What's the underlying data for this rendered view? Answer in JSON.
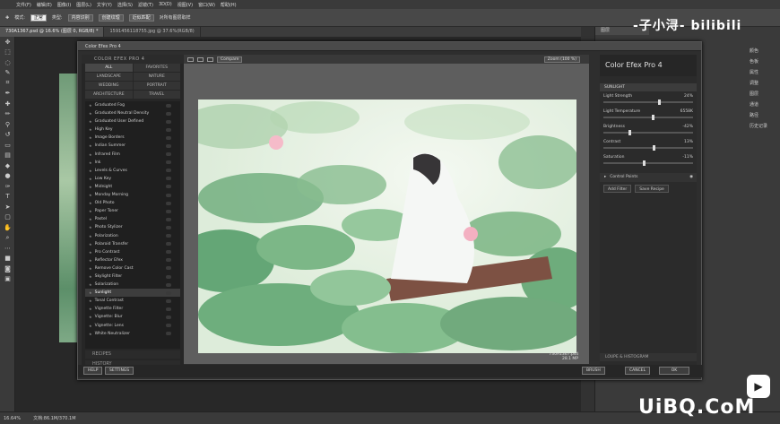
{
  "menu": [
    "文件(F)",
    "编辑(E)",
    "图像(I)",
    "图层(L)",
    "文字(Y)",
    "选择(S)",
    "滤镜(T)",
    "3D(D)",
    "视图(V)",
    "窗口(W)",
    "帮助(H)"
  ],
  "options": {
    "mode_label": "模式:",
    "mode_value": "正常",
    "type_label": "类型:",
    "btn1": "内容识别",
    "btn2": "创建纹理",
    "btn3": "近似匹配",
    "sample_all": "对所有图层取样"
  },
  "doc_tabs": [
    "730A1367.psd @ 16.6% (图层 0, RGB/8) *",
    "1591456118755.jpg @ 37.6%(RGB/8)"
  ],
  "right_panel": {
    "tab": "图层",
    "items": [
      "颜色",
      "色板",
      "属性",
      "调整",
      "图层",
      "通道",
      "路径",
      "历史记录"
    ]
  },
  "cef": {
    "window_title": "Color Efex Pro 4",
    "brand": "COLOR EFEX PRO 4",
    "categories": [
      "ALL",
      "FAVORITES",
      "LANDSCAPE",
      "NATURE",
      "WEDDING",
      "PORTRAIT",
      "ARCHITECTURE",
      "TRAVEL"
    ],
    "filters": [
      "Graduated Fog",
      "Graduated Neutral Density",
      "Graduated User Defined",
      "High Key",
      "Image Borders",
      "Indian Summer",
      "Infrared Film",
      "Ink",
      "Levels & Curves",
      "Low Key",
      "Midnight",
      "Monday Morning",
      "Old Photo",
      "Paper Toner",
      "Pastel",
      "Photo Stylizer",
      "Polarization",
      "Polaroid Transfer",
      "Pro Contrast",
      "Reflector Efex",
      "Remove Color Cast",
      "Skylight Filter",
      "Solarization",
      "Sunlight",
      "Tonal Contrast",
      "Vignette Filter",
      "Vignette: Blur",
      "Vignette: Lens",
      "White Neutralizer"
    ],
    "selected_filter": "Sunlight",
    "recipes": "RECIPES",
    "history": "HISTORY",
    "compare": "Compare",
    "zoom": "Zoom (100 %)",
    "file_name": "730A1367.psd",
    "file_size": "28.1 MP",
    "logo": "Color Efex Pro 4",
    "active_filter": "SUNLIGHT",
    "params": [
      {
        "label": "Light Strength",
        "value": "24%",
        "pos": 0.62
      },
      {
        "label": "Light Temperature",
        "value": "6558K",
        "pos": 0.55
      },
      {
        "label": "Brightness",
        "value": "-42%",
        "pos": 0.29
      },
      {
        "label": "Contrast",
        "value": "13%",
        "pos": 0.56
      },
      {
        "label": "Saturation",
        "value": "-11%",
        "pos": 0.45
      }
    ],
    "control_points": "Control Points",
    "add_filter": "Add Filter",
    "save_recipe": "Save Recipe",
    "loupe": "LOUPE & HISTOGRAM",
    "help": "HELP",
    "settings": "SETTINGS",
    "brush": "BRUSH",
    "cancel": "CANCEL",
    "ok": "OK"
  },
  "status": {
    "zoom": "16.64%",
    "doc": "文档:86.1M/370.1M"
  },
  "watermark": "-子小浔-",
  "watermark_logo": "bilibili",
  "watermark_bottom": "UiBQ.CoM"
}
